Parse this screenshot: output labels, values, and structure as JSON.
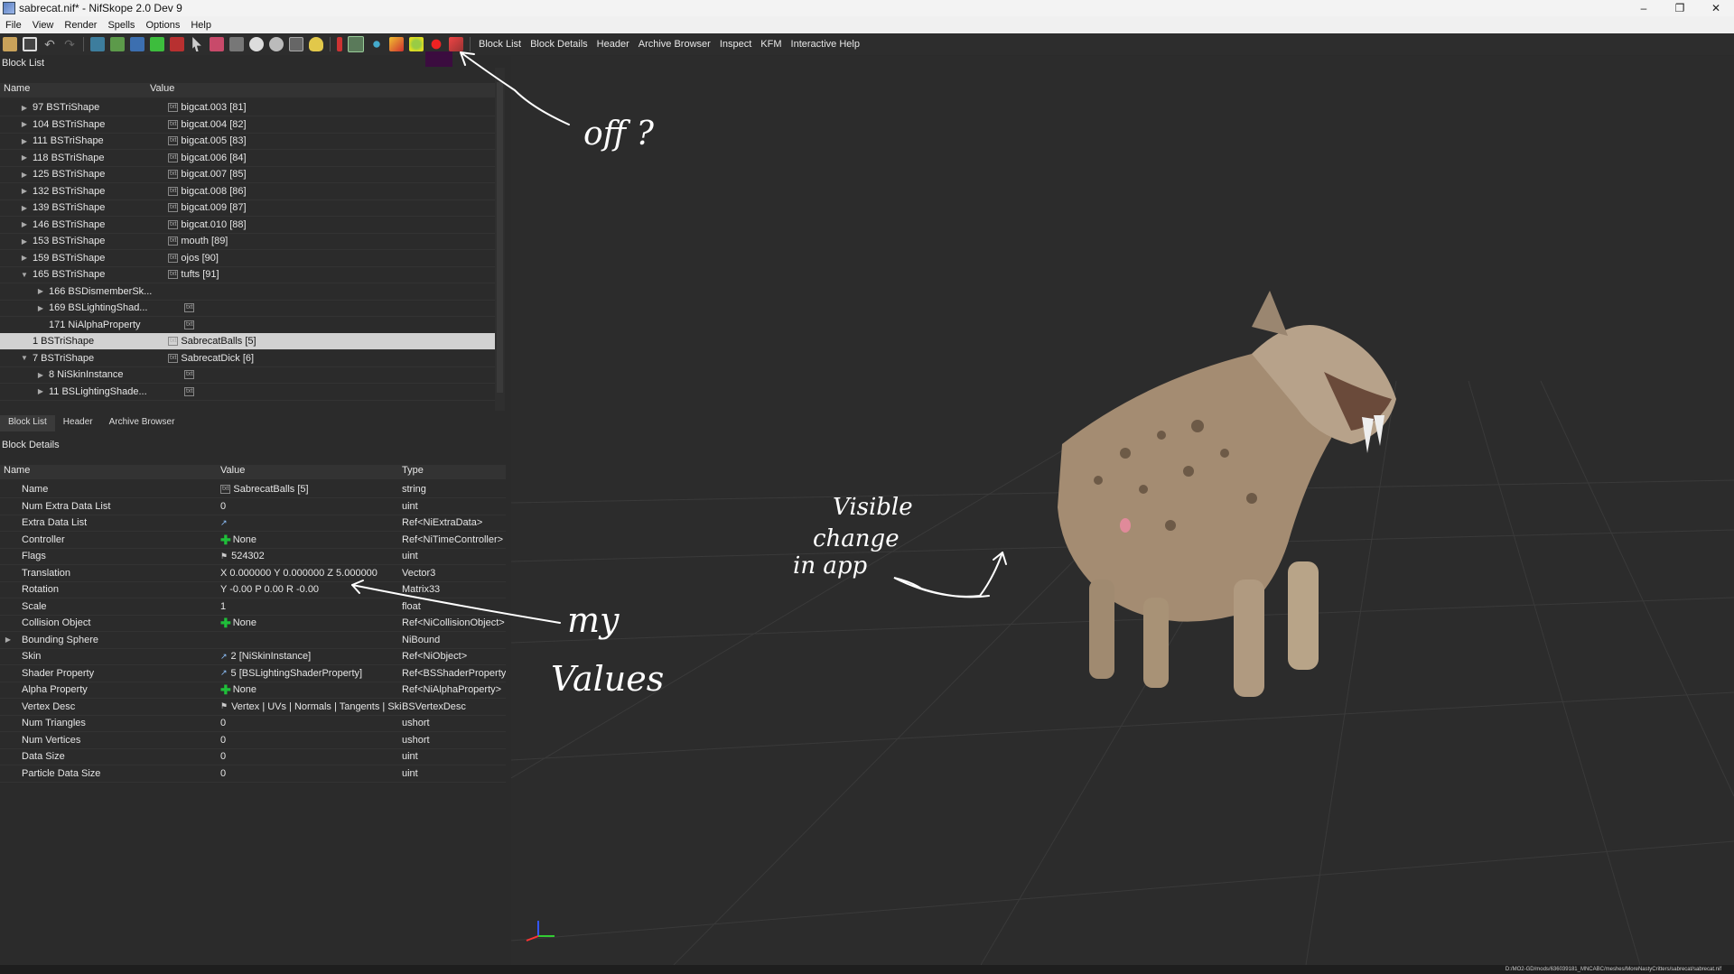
{
  "window": {
    "title": "sabrecat.nif* - NifSkope 2.0 Dev 9",
    "controls": [
      "–",
      "❐",
      "✕"
    ]
  },
  "menu": [
    "File",
    "View",
    "Render",
    "Spells",
    "Options",
    "Help"
  ],
  "toolbar_links": [
    "Block List",
    "Block Details",
    "Header",
    "Archive Browser",
    "Inspect",
    "KFM",
    "Interactive Help"
  ],
  "block_list": {
    "title": "Block List",
    "columns": [
      "Name",
      "Value"
    ],
    "rows": [
      {
        "arrow": "▶",
        "name": "97 BSTriShape",
        "value": "bigcat.003 [81]",
        "indent": 0
      },
      {
        "arrow": "▶",
        "name": "104 BSTriShape",
        "value": "bigcat.004 [82]",
        "indent": 0
      },
      {
        "arrow": "▶",
        "name": "111 BSTriShape",
        "value": "bigcat.005 [83]",
        "indent": 0
      },
      {
        "arrow": "▶",
        "name": "118 BSTriShape",
        "value": "bigcat.006 [84]",
        "indent": 0
      },
      {
        "arrow": "▶",
        "name": "125 BSTriShape",
        "value": "bigcat.007 [85]",
        "indent": 0
      },
      {
        "arrow": "▶",
        "name": "132 BSTriShape",
        "value": "bigcat.008 [86]",
        "indent": 0
      },
      {
        "arrow": "▶",
        "name": "139 BSTriShape",
        "value": "bigcat.009 [87]",
        "indent": 0
      },
      {
        "arrow": "▶",
        "name": "146 BSTriShape",
        "value": "bigcat.010 [88]",
        "indent": 0
      },
      {
        "arrow": "▶",
        "name": "153 BSTriShape",
        "value": "mouth [89]",
        "indent": 0
      },
      {
        "arrow": "▶",
        "name": "159 BSTriShape",
        "value": "ojos [90]",
        "indent": 0
      },
      {
        "arrow": "▼",
        "name": "165 BSTriShape",
        "value": "tufts [91]",
        "indent": 0
      },
      {
        "arrow": "▶",
        "name": "166 BSDismemberSk...",
        "value": "",
        "indent": 1
      },
      {
        "arrow": "▶",
        "name": "169 BSLightingShad...",
        "value": "",
        "indent": 1
      },
      {
        "arrow": "",
        "name": "171 NiAlphaProperty",
        "value": "",
        "indent": 1
      },
      {
        "arrow": "",
        "name": "1 BSTriShape",
        "value": "SabrecatBalls [5]",
        "indent": 0,
        "selected": true
      },
      {
        "arrow": "▼",
        "name": "7 BSTriShape",
        "value": "SabrecatDick [6]",
        "indent": 0
      },
      {
        "arrow": "▶",
        "name": "8 NiSkinInstance",
        "value": "",
        "indent": 1
      },
      {
        "arrow": "▶",
        "name": "11 BSLightingShade...",
        "value": "",
        "indent": 1
      }
    ]
  },
  "bottom_tabs": [
    "Block List",
    "Header",
    "Archive Browser"
  ],
  "block_details": {
    "title": "Block Details",
    "columns": [
      "Name",
      "Value",
      "Type"
    ],
    "rows": [
      {
        "name": "Name",
        "value": "SabrecatBalls [5]",
        "type": "string",
        "icon": "txt"
      },
      {
        "name": "Num Extra Data List",
        "value": "0",
        "type": "uint"
      },
      {
        "name": "Extra Data List",
        "value": "",
        "type": "Ref<NiExtraData>",
        "icon": "link"
      },
      {
        "name": "Controller",
        "value": "None",
        "type": "Ref<NiTimeController>",
        "icon": "plus"
      },
      {
        "name": "Flags",
        "value": "524302",
        "type": "uint",
        "icon": "flag"
      },
      {
        "name": "Translation",
        "value": "X 0.000000 Y 0.000000 Z 5.000000",
        "type": "Vector3"
      },
      {
        "name": "Rotation",
        "value": "Y -0.00 P 0.00 R -0.00",
        "type": "Matrix33"
      },
      {
        "name": "Scale",
        "value": "1",
        "type": "float"
      },
      {
        "name": "Collision Object",
        "value": "None",
        "type": "Ref<NiCollisionObject>",
        "icon": "plus"
      },
      {
        "name": "Bounding Sphere",
        "value": "",
        "type": "NiBound",
        "expand": true
      },
      {
        "name": "Skin",
        "value": "2 [NiSkinInstance]",
        "type": "Ref<NiObject>",
        "icon": "link"
      },
      {
        "name": "Shader Property",
        "value": "5 [BSLightingShaderProperty]",
        "type": "Ref<BSShaderProperty>",
        "icon": "link"
      },
      {
        "name": "Alpha Property",
        "value": "None",
        "type": "Ref<NiAlphaProperty>",
        "icon": "plus"
      },
      {
        "name": "Vertex Desc",
        "value": "Vertex | UVs | Normals | Tangents | Ski...",
        "type": "BSVertexDesc",
        "icon": "flag"
      },
      {
        "name": "Num Triangles",
        "value": "0",
        "type": "ushort"
      },
      {
        "name": "Num Vertices",
        "value": "0",
        "type": "ushort"
      },
      {
        "name": "Data Size",
        "value": "0",
        "type": "uint"
      },
      {
        "name": "Particle Data Size",
        "value": "0",
        "type": "uint"
      }
    ]
  },
  "annotations": {
    "off": "off ?",
    "visible_1": "Visible",
    "visible_2": "change",
    "visible_3": "in app",
    "my": "my",
    "values": "Values"
  },
  "status_path": "D:/MO2-GD/mods/636039181_MNCABC/meshes/MoreNastyCritters/sabrecat/sabrecat.nif",
  "colors": {
    "selection": "#d2d2d2",
    "add_icon": "#1fbf3a",
    "viewport_bg": "#2c2c2c"
  }
}
